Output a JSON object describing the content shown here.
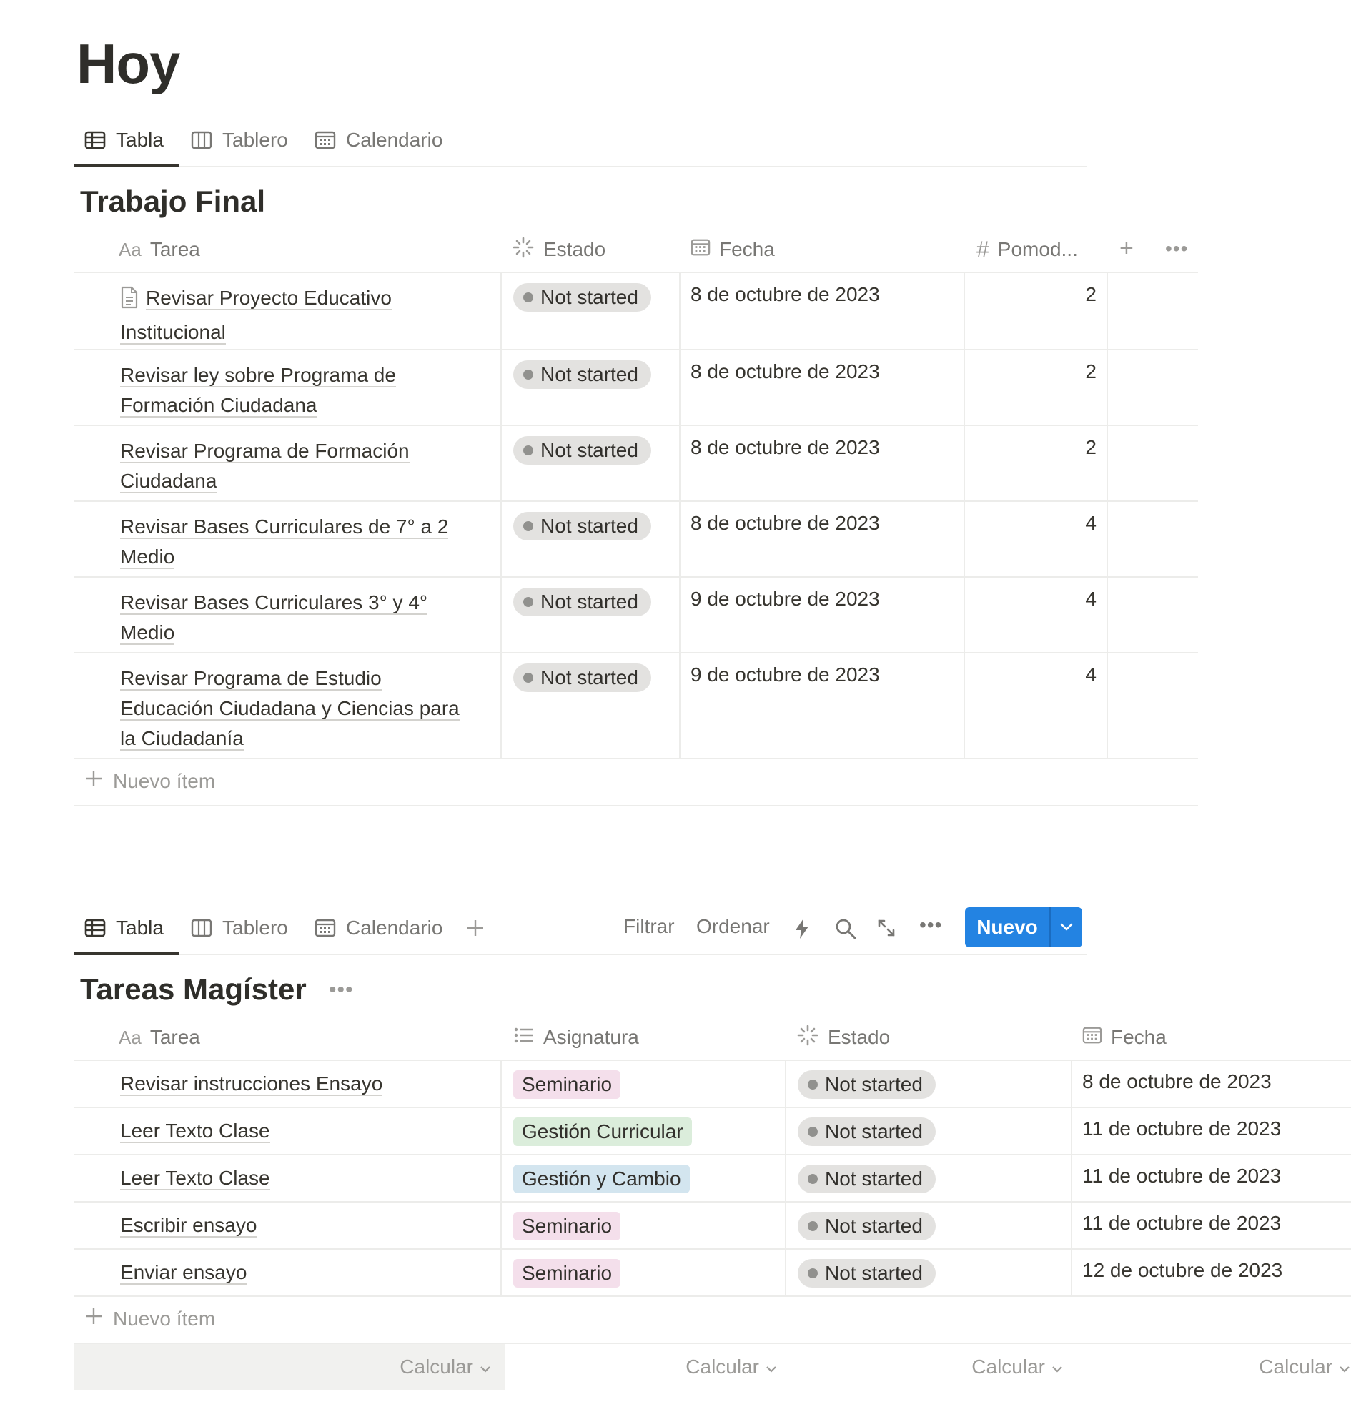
{
  "page": {
    "title": "Hoy"
  },
  "views1": {
    "tabs": [
      {
        "label": "Tabla"
      },
      {
        "label": "Tablero"
      },
      {
        "label": "Calendario"
      }
    ]
  },
  "db1": {
    "title": "Trabajo Final",
    "columns": [
      {
        "prefix": "Aa",
        "label": "Tarea"
      },
      {
        "label": "Estado"
      },
      {
        "label": "Fecha"
      },
      {
        "prefix": "#",
        "label": "Pomod..."
      }
    ],
    "rows": [
      {
        "task_lines": [
          "Revisar Proyecto Educativo",
          "Institucional"
        ],
        "has_doc_icon": true,
        "estado": "Not started",
        "fecha": "8 de octubre de 2023",
        "pomodoros": "2"
      },
      {
        "task_lines": [
          "Revisar ley sobre Programa de",
          "Formación Ciudadana"
        ],
        "estado": "Not started",
        "fecha": "8 de octubre de 2023",
        "pomodoros": "2"
      },
      {
        "task_lines": [
          "Revisar Programa de Formación",
          "Ciudadana"
        ],
        "estado": "Not started",
        "fecha": "8 de octubre de 2023",
        "pomodoros": "2"
      },
      {
        "task_lines": [
          "Revisar Bases Curriculares de 7° a 2",
          "Medio"
        ],
        "estado": "Not started",
        "fecha": "8 de octubre de 2023",
        "pomodoros": "4"
      },
      {
        "task_lines": [
          "Revisar Bases Curriculares 3° y 4°",
          "Medio"
        ],
        "estado": "Not started",
        "fecha": "9 de octubre de 2023",
        "pomodoros": "4"
      },
      {
        "task_lines": [
          "Revisar Programa de Estudio",
          "Educación Ciudadana y Ciencias para",
          "la Ciudadanía"
        ],
        "estado": "Not started",
        "fecha": "9 de octubre de 2023",
        "pomodoros": "4"
      }
    ],
    "new_item": "Nuevo ítem"
  },
  "views2": {
    "tabs": [
      {
        "label": "Tabla"
      },
      {
        "label": "Tablero"
      },
      {
        "label": "Calendario"
      }
    ],
    "toolbar": {
      "filter": "Filtrar",
      "sort": "Ordenar",
      "new_button": "Nuevo"
    }
  },
  "db2": {
    "title": "Tareas Magíster",
    "columns": [
      {
        "prefix": "Aa",
        "label": "Tarea"
      },
      {
        "label": "Asignatura"
      },
      {
        "label": "Estado"
      },
      {
        "label": "Fecha"
      }
    ],
    "rows": [
      {
        "task": "Revisar instrucciones Ensayo",
        "asignatura": "Seminario",
        "estado": "Not started",
        "fecha": "8 de octubre de 2023"
      },
      {
        "task": "Leer Texto Clase",
        "asignatura": "Gestión Curricular",
        "estado": "Not started",
        "fecha": "11 de octubre de 2023"
      },
      {
        "task": "Leer Texto Clase",
        "asignatura": "Gestión y Cambio",
        "estado": "Not started",
        "fecha": "11 de octubre de 2023"
      },
      {
        "task": "Escribir ensayo",
        "asignatura": "Seminario",
        "estado": "Not started",
        "fecha": "11 de octubre de 2023"
      },
      {
        "task": "Enviar ensayo",
        "asignatura": "Seminario",
        "estado": "Not started",
        "fecha": "12 de octubre de 2023"
      }
    ],
    "new_item": "Nuevo ítem",
    "calculate_label": "Calcular"
  },
  "colors": {
    "accent": "#2383e2",
    "status_pill_bg": "#e3e2e0",
    "status_dot": "#91918e",
    "tag_seminario": "#f4dfeb",
    "tag_gestion_curricular": "#dbeddb",
    "tag_gestion_cambio": "#d3e5ef",
    "calc_shade": "#f1f1ef"
  }
}
